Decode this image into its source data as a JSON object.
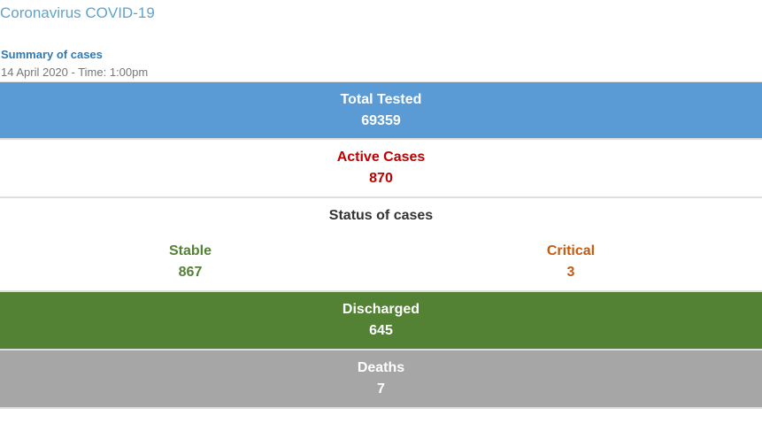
{
  "page": {
    "title": "Coronavirus COVID-19"
  },
  "summary": {
    "title": "Summary of cases",
    "date": "14 April 2020 - Time: 1:00pm"
  },
  "stats": {
    "total_tested": {
      "label": "Total Tested",
      "value": "69359",
      "color": "#5b9bd5"
    },
    "active_cases": {
      "label": "Active Cases",
      "value": "870",
      "color": "#c00000"
    },
    "status": {
      "label": "Status of cases",
      "stable": {
        "label": "Stable",
        "value": "867",
        "color": "#548235"
      },
      "critical": {
        "label": "Critical",
        "value": "3",
        "color": "#c55a11"
      }
    },
    "discharged": {
      "label": "Discharged",
      "value": "645",
      "color": "#548235"
    },
    "deaths": {
      "label": "Deaths",
      "value": "7",
      "color": "#a6a6a6"
    }
  }
}
